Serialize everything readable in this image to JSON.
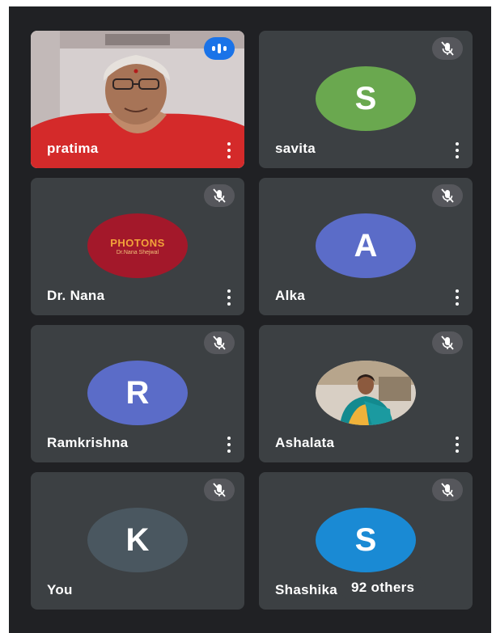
{
  "colors": {
    "background": "#202124",
    "tile": "#3c4043",
    "speaking_blue": "#1a73e8",
    "avatar_green": "#6aa84f",
    "avatar_indigo": "#5b6cc8",
    "avatar_slate": "#4a5760",
    "avatar_blue": "#1a8ad4",
    "logo_red": "#a3182a"
  },
  "participants": [
    {
      "name": "pratima",
      "type": "video",
      "status": "speaking"
    },
    {
      "name": "savita",
      "type": "avatar",
      "initial": "S",
      "status": "muted"
    },
    {
      "name": "Dr. Nana",
      "type": "logo",
      "logo_title": "PHOTONS",
      "logo_subtitle": "Dr.Nana Shejwal",
      "status": "muted"
    },
    {
      "name": "Alka",
      "type": "avatar",
      "initial": "A",
      "status": "muted"
    },
    {
      "name": "Ramkrishna",
      "type": "avatar",
      "initial": "R",
      "status": "muted"
    },
    {
      "name": "Ashalata",
      "type": "photo",
      "status": "muted"
    },
    {
      "name": "You",
      "type": "avatar",
      "initial": "K",
      "status": "muted"
    },
    {
      "name": "Shashika",
      "type": "avatar",
      "initial": "S",
      "status": "muted"
    }
  ],
  "others_label": "92 others",
  "icons": {
    "mute": "mic-off-icon",
    "speaking": "audio-level-icon",
    "more": "more-vert-icon"
  }
}
